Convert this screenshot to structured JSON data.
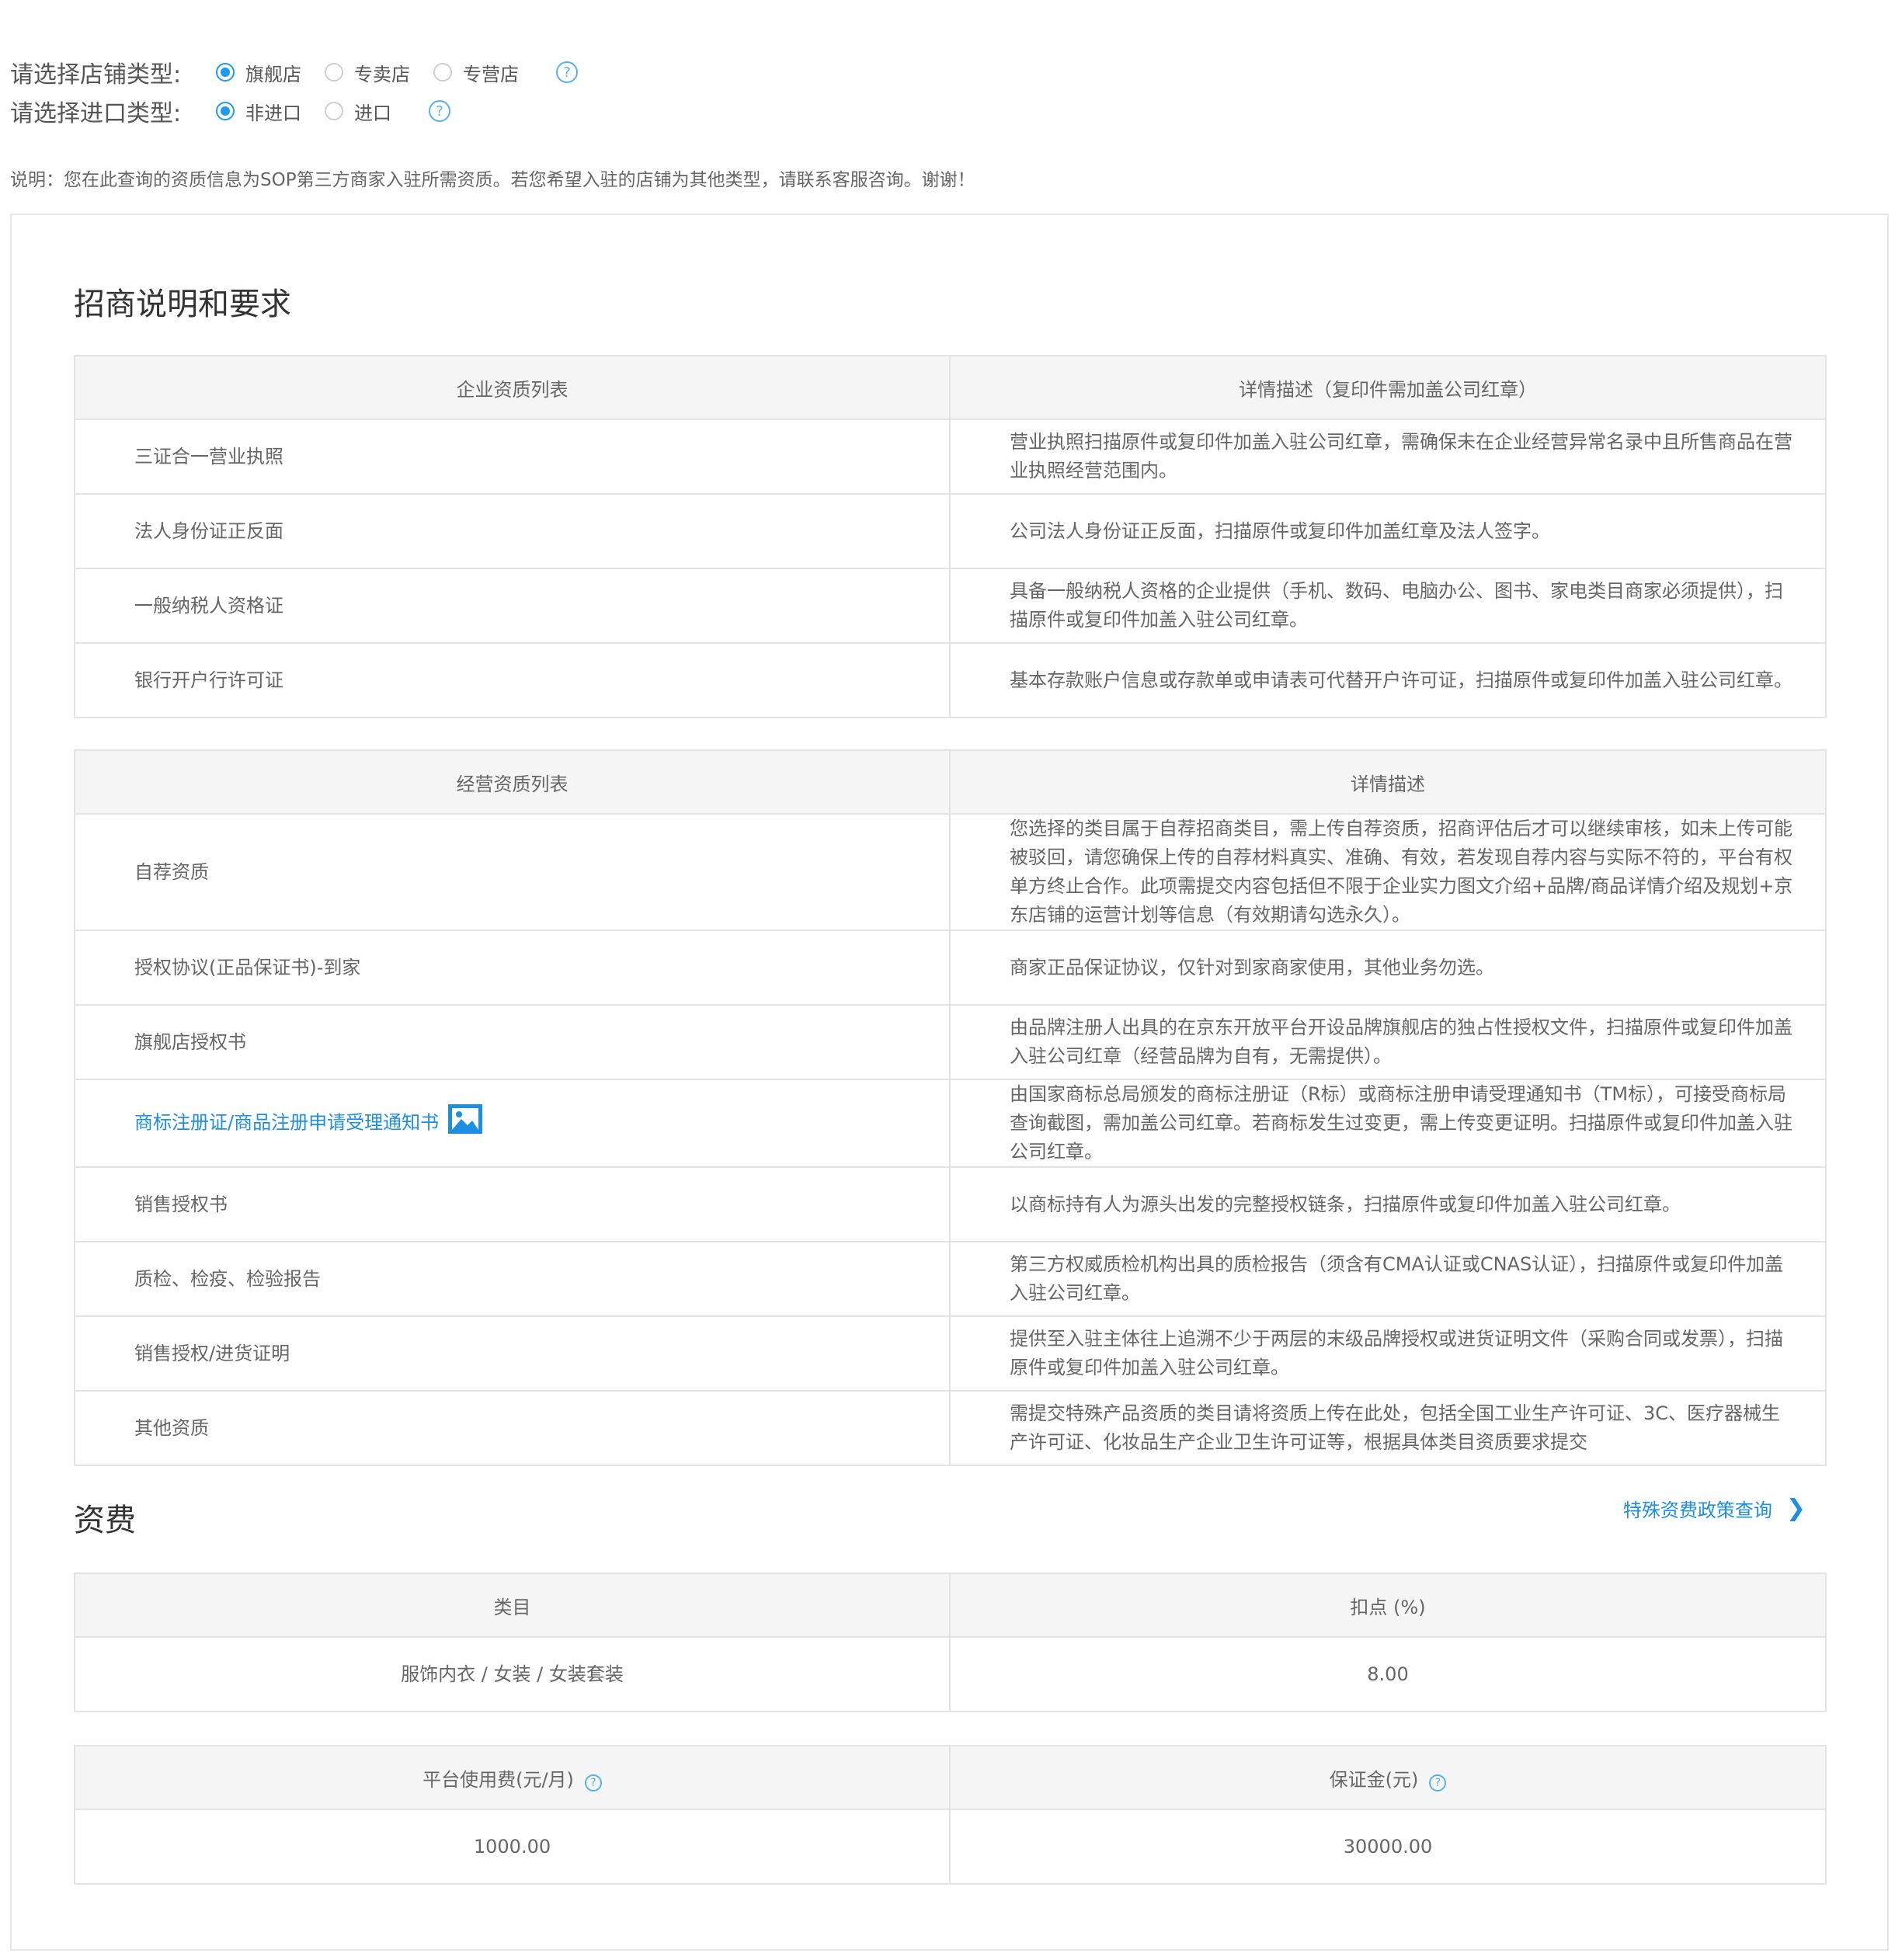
{
  "store_type": {
    "label": "请选择店铺类型:",
    "options": [
      "旗舰店",
      "专卖店",
      "专营店"
    ],
    "selected": "旗舰店"
  },
  "import_type": {
    "label": "请选择进口类型:",
    "options": [
      "非进口",
      "进口"
    ],
    "selected": "非进口"
  },
  "note": "说明：您在此查询的资质信息为SOP第三方商家入驻所需资质。若您希望入驻的店铺为其他类型，请联系客服咨询。谢谢！",
  "requirements": {
    "title": "招商说明和要求",
    "enterprise": {
      "headers": [
        "企业资质列表",
        "详情描述（复印件需加盖公司红章）"
      ],
      "rows": [
        {
          "name": "三证合一营业执照",
          "desc": "营业执照扫描原件或复印件加盖入驻公司红章，需确保未在企业经营异常名录中且所售商品在营业执照经营范围内。"
        },
        {
          "name": "法人身份证正反面",
          "desc": "公司法人身份证正反面，扫描原件或复印件加盖红章及法人签字。"
        },
        {
          "name": "一般纳税人资格证",
          "desc": "具备一般纳税人资格的企业提供（手机、数码、电脑办公、图书、家电类目商家必须提供），扫描原件或复印件加盖入驻公司红章。"
        },
        {
          "name": "银行开户行许可证",
          "desc": "基本存款账户信息或存款单或申请表可代替开户许可证，扫描原件或复印件加盖入驻公司红章。"
        }
      ]
    },
    "business": {
      "headers": [
        "经营资质列表",
        "详情描述"
      ],
      "rows": [
        {
          "name": "自荐资质",
          "desc": "您选择的类目属于自荐招商类目，需上传自荐资质，招商评估后才可以继续审核，如未上传可能被驳回，请您确保上传的自荐材料真实、准确、有效，若发现自荐内容与实际不符的，平台有权单方终止合作。此项需提交内容包括但不限于企业实力图文介绍+品牌/商品详情介绍及规划+京东店铺的运营计划等信息（有效期请勾选永久）。"
        },
        {
          "name": "授权协议(正品保证书)-到家",
          "desc": "商家正品保证协议，仅针对到家商家使用，其他业务勿选。"
        },
        {
          "name": "旗舰店授权书",
          "desc": "由品牌注册人出具的在京东开放平台开设品牌旗舰店的独占性授权文件，扫描原件或复印件加盖入驻公司红章（经营品牌为自有，无需提供）。"
        },
        {
          "name": "商标注册证/商品注册申请受理通知书",
          "desc": "由国家商标总局颁发的商标注册证（R标）或商标注册申请受理通知书（TM标），可接受商标局查询截图，需加盖公司红章。若商标发生过变更，需上传变更证明。扫描原件或复印件加盖入驻公司红章。",
          "link": true
        },
        {
          "name": "销售授权书",
          "desc": "以商标持有人为源头出发的完整授权链条，扫描原件或复印件加盖入驻公司红章。"
        },
        {
          "name": "质检、检疫、检验报告",
          "desc": "第三方权威质检机构出具的质检报告（须含有CMA认证或CNAS认证），扫描原件或复印件加盖入驻公司红章。"
        },
        {
          "name": "销售授权/进货证明",
          "desc": "提供至入驻主体往上追溯不少于两层的末级品牌授权或进货证明文件（采购合同或发票），扫描原件或复印件加盖入驻公司红章。"
        },
        {
          "name": "其他资质",
          "desc": "需提交特殊产品资质的类目请将资质上传在此处，包括全国工业生产许可证、3C、医疗器械生产许可证、化妆品生产企业卫生许可证等，根据具体类目资质要求提交"
        }
      ]
    }
  },
  "fees": {
    "title": "资费",
    "policy_link": "特殊资费政策查询",
    "commission": {
      "headers": [
        "类目",
        "扣点 (%)"
      ],
      "category": "服饰内衣 / 女装 / 女装套装",
      "rate": "8.00"
    },
    "platform": {
      "headers": [
        "平台使用费(元/月)",
        "保证金(元)"
      ],
      "usage_fee": "1000.00",
      "deposit": "30000.00"
    }
  },
  "colors": {
    "accent": "#1d9bf0",
    "link": "#1d8fe0",
    "header_bg": "#f5f5f5",
    "border": "#e4e4e4"
  },
  "icons": {
    "help": "question-circle-icon",
    "image": "picture-icon",
    "chevron": "chevron-right-icon"
  }
}
